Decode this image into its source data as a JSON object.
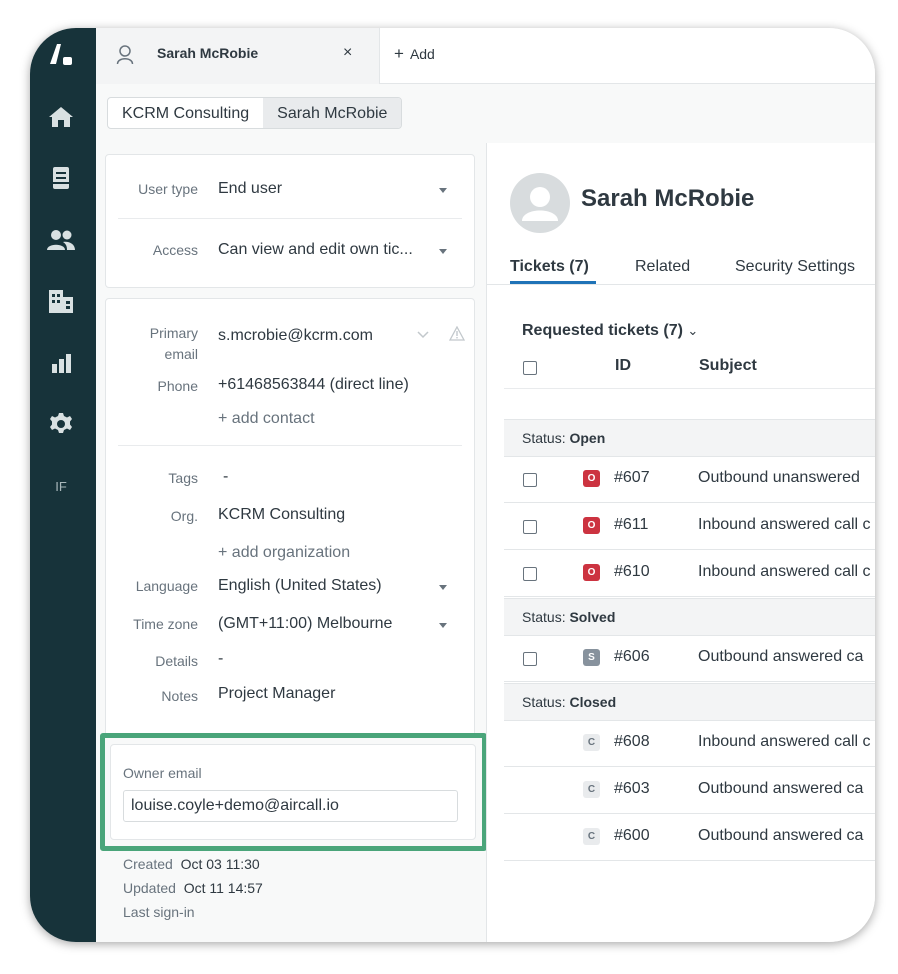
{
  "tab": {
    "title": "Sarah McRobie",
    "close": "×",
    "add_label": "Add"
  },
  "breadcrumb": [
    "KCRM Consulting",
    "Sarah McRobie"
  ],
  "sidebar": {
    "footer_text": "IF"
  },
  "user_fields": {
    "user_type_label": "User type",
    "user_type_value": "End user",
    "access_label": "Access",
    "access_value": "Can view and edit own tic..."
  },
  "contact": {
    "primary_email_label_1": "Primary",
    "primary_email_label_2": "email",
    "primary_email": "s.mcrobie@kcrm.com",
    "phone_label": "Phone",
    "phone": "+61468563844 (direct line)",
    "add_contact": "+ add contact"
  },
  "details": {
    "tags_label": "Tags",
    "tags_value": "-",
    "org_label": "Org.",
    "org_value": "KCRM Consulting",
    "add_org": "+ add organization",
    "language_label": "Language",
    "language_value": "English (United States)",
    "timezone_label": "Time zone",
    "timezone_value": "(GMT+11:00) Melbourne",
    "details_label": "Details",
    "details_value": "-",
    "notes_label": "Notes",
    "notes_value": "Project Manager"
  },
  "owner": {
    "label": "Owner email",
    "value": "louise.coyle+demo@aircall.io"
  },
  "meta": {
    "created_label": "Created",
    "created_value": "Oct 03 11:30",
    "updated_label": "Updated",
    "updated_value": "Oct 11 14:57",
    "last_signin_label": "Last sign-in"
  },
  "profile": {
    "name": "Sarah McRobie"
  },
  "tabs": [
    "Tickets (7)",
    "Related",
    "Security Settings"
  ],
  "tickets_section": {
    "title": "Requested tickets (7)",
    "col_id": "ID",
    "col_subject": "Subject"
  },
  "groups": [
    {
      "prefix": "Status: ",
      "status": "Open"
    },
    {
      "prefix": "Status: ",
      "status": "Solved"
    },
    {
      "prefix": "Status: ",
      "status": "Closed"
    }
  ],
  "tickets": [
    {
      "badge": "O",
      "id": "#607",
      "subject": "Outbound unanswered"
    },
    {
      "badge": "O",
      "id": "#611",
      "subject": "Inbound answered call c"
    },
    {
      "badge": "O",
      "id": "#610",
      "subject": "Inbound answered call c"
    },
    {
      "badge": "S",
      "id": "#606",
      "subject": "Outbound answered ca"
    },
    {
      "badge": "C",
      "id": "#608",
      "subject": "Inbound answered call c"
    },
    {
      "badge": "C",
      "id": "#603",
      "subject": "Outbound answered ca"
    },
    {
      "badge": "C",
      "id": "#600",
      "subject": "Outbound answered ca"
    }
  ],
  "colors": {
    "sidebar": "#17333a",
    "highlight": "#4aa57a",
    "open": "#cc3340",
    "solved": "#87929d",
    "accent": "#1f73b7"
  }
}
